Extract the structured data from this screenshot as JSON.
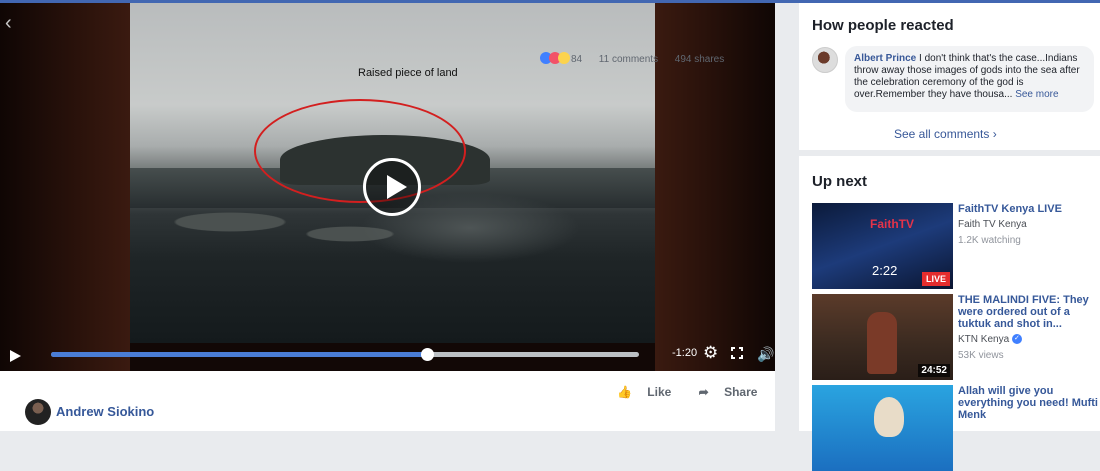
{
  "video": {
    "annotation": "Raised piece of land",
    "time_remaining": "-1:20",
    "progress_percent": 64
  },
  "post": {
    "like_label": "Like",
    "share_label": "Share",
    "more_label": "•••",
    "author": "Andrew Siokino",
    "reaction_count": "84",
    "comments_count": "11 comments",
    "shares_count": "494 shares"
  },
  "reacted": {
    "title": "How people reacted",
    "comment_author": "Albert Prince",
    "comment_text": " I don't think that's the case...Indians throw away those images of gods into the sea after the celebration ceremony of the god is over.Remember they have thousa...",
    "see_more": " See more",
    "see_all": "See all comments"
  },
  "upnext": {
    "title": "Up next",
    "videos": [
      {
        "title": "FaithTV Kenya LIVE",
        "channel": "Faith TV Kenya",
        "meta": "1.2K watching",
        "badge": "LIVE",
        "thumb_time": "2:22"
      },
      {
        "title": "THE MALINDI FIVE: They were ordered out of a tuktuk and shot in...",
        "channel": "KTN Kenya",
        "meta": "53K views",
        "duration": "24:52"
      },
      {
        "title": "Allah will give you everything you need! Mufti Menk",
        "channel": "",
        "meta": ""
      }
    ]
  },
  "icons": [
    "back-chevron-icon",
    "play-icon",
    "gear-icon",
    "fullscreen-icon",
    "volume-icon",
    "like-icon",
    "share-icon",
    "verified-icon"
  ]
}
